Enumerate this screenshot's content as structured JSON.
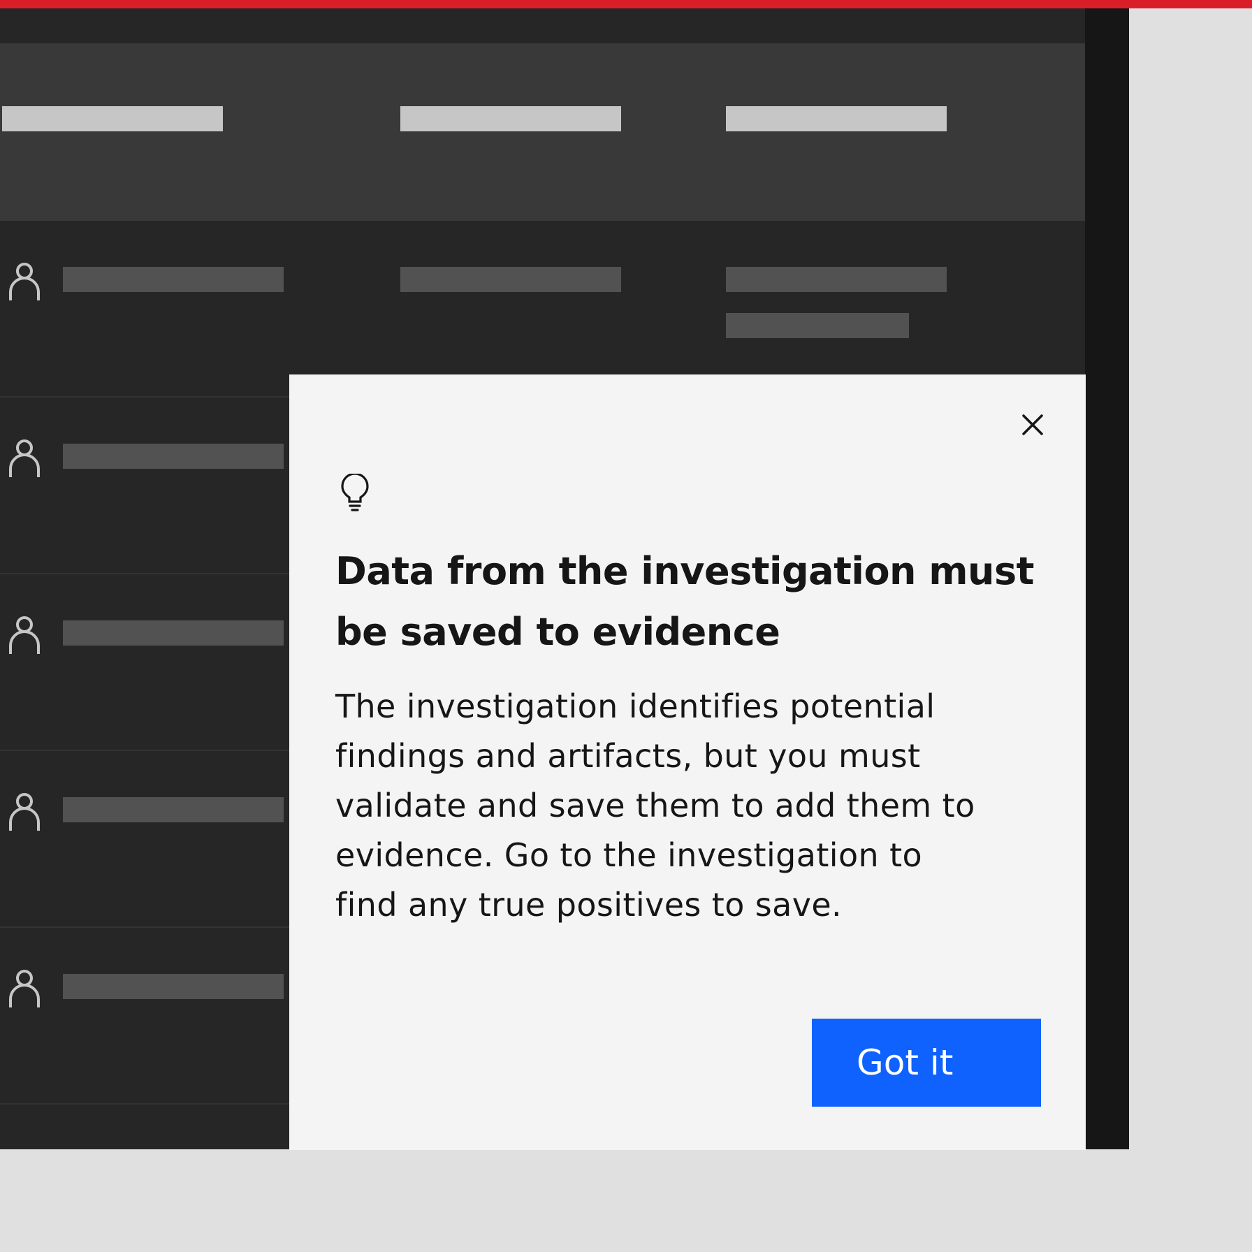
{
  "colors": {
    "accent_bar": "#da1e28",
    "primary_button": "#0f62fe",
    "table_header_bg": "#393939",
    "table_body_bg": "#262626",
    "popover_bg": "#f4f4f4"
  },
  "table": {
    "row_icon": "user-icon",
    "row_count_visible": 6
  },
  "popover": {
    "icon": "lightbulb-icon",
    "close_icon": "close-icon",
    "title": "Data from the investigation must be saved to evidence",
    "body": "The investigation identifies potential findings and artifacts, but you must validate and save them to add them to evidence. Go to the investigation to find any true positives to save.",
    "primary_button_label": "Got it"
  }
}
